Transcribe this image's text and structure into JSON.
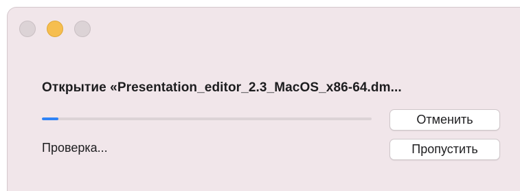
{
  "window": {
    "controls": [
      "close",
      "minimize",
      "maximize"
    ],
    "colors": {
      "background": "#f1e6ea",
      "minimize": "#f6be4f",
      "accent": "#2f83f6"
    }
  },
  "dialog": {
    "title": "Открытие «Presentation_editor_2.3_MacOS_x86-64.dm...",
    "progress_percent": 5,
    "status": "Проверка..."
  },
  "buttons": {
    "cancel_label": "Отменить",
    "skip_label": "Пропустить"
  }
}
